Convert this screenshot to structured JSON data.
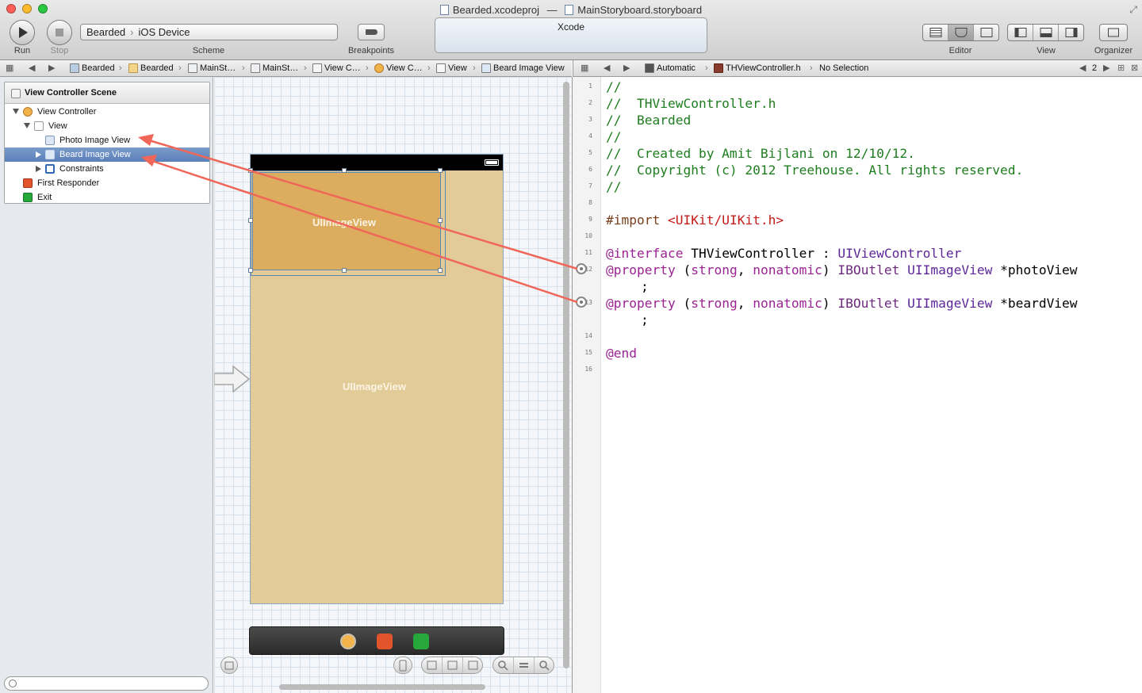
{
  "window": {
    "project_file": "Bearded.xcodeproj",
    "title_separator": "—",
    "storyboard_file": "MainStoryboard.storyboard"
  },
  "toolbar": {
    "run_label": "Run",
    "stop_label": "Stop",
    "scheme_name": "Bearded",
    "scheme_device": "iOS Device",
    "scheme_label": "Scheme",
    "breakpoints_label": "Breakpoints",
    "activity_text": "Xcode",
    "editor_label": "Editor",
    "view_label": "View",
    "organizer_label": "Organizer"
  },
  "left_jumpbar": {
    "items": [
      "Bearded",
      "Bearded",
      "MainSt…",
      "MainSt…",
      "View C…",
      "View C…",
      "View",
      "Beard Image View"
    ]
  },
  "right_jumpbar": {
    "mode": "Automatic",
    "file": "THViewController.h",
    "selection": "No Selection",
    "count": "2"
  },
  "outline": {
    "scene_title": "View Controller Scene",
    "rows": [
      {
        "label": "View Controller",
        "icon": "view-controller-icon"
      },
      {
        "label": "View",
        "icon": "view-icon"
      },
      {
        "label": "Photo Image View",
        "icon": "image-view-icon"
      },
      {
        "label": "Beard Image View",
        "icon": "image-view-icon",
        "selected": true
      },
      {
        "label": "Constraints",
        "icon": "constraints-icon"
      },
      {
        "label": "First Responder",
        "icon": "first-responder-icon"
      },
      {
        "label": "Exit",
        "icon": "exit-icon"
      }
    ]
  },
  "canvas": {
    "photo_view_label": "UIImageView",
    "beard_view_label": "UIImageView"
  },
  "editor": {
    "line_numbers": [
      "1",
      "2",
      "3",
      "4",
      "5",
      "6",
      "7",
      "8",
      "9",
      "10",
      "11",
      "12",
      "13",
      "14",
      "15",
      "16"
    ],
    "lines": {
      "l1": "//",
      "l2": "//  THViewController.h",
      "l3": "//  Bearded",
      "l4": "//",
      "l5": "//  Created by Amit Bijlani on 12/10/12.",
      "l6": "//  Copyright (c) 2012 Treehouse. All rights reserved.",
      "l7": "//",
      "import_kw": "#import",
      "import_path": "<UIKit/UIKit.h>",
      "interface_kw": "@interface",
      "class_name": "THViewController",
      "colon": " : ",
      "superclass": "UIViewController",
      "property_kw": "@property",
      "attrs_open": " (",
      "strong_kw": "strong",
      "comma": ", ",
      "nonatomic_kw": "nonatomic",
      "attrs_close": ") ",
      "iboutlet": "IBOutlet",
      "imageview_type": "UIImageView",
      "photo_var": " *photoView",
      "beard_var": " *beardView",
      "semicolon": ";",
      "end_kw": "@end"
    }
  },
  "colors": {
    "annotation_arrow": "#f0675a",
    "selection": "#5a7fb8",
    "comment": "#1e7d1e",
    "keyword": "#9b2393"
  }
}
